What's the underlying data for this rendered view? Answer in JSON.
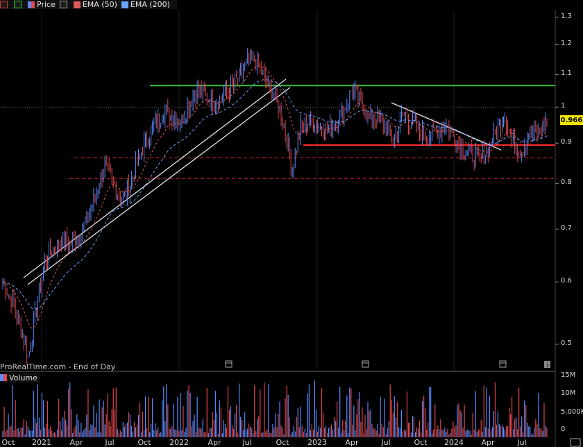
{
  "toolbar": {
    "price_label": "Price",
    "ema50_label": "EMA (50)",
    "ema200_label": "EMA (200)"
  },
  "source_label": "ProRealTime.com - End of Day",
  "volume_label": "Volume",
  "last_price": "0.966",
  "colors": {
    "background": "#000000",
    "up_candle": "#5b8cff",
    "down_candle": "#e0474c",
    "ema50": "#e05a5a",
    "ema200": "#6aa0ff",
    "resistance": "#39c639",
    "support": "#ff2a2a",
    "trendline": "#e8e8e8",
    "price_tag": "#f2e600"
  },
  "chart_data": {
    "type": "line",
    "y_axis_scale": "log",
    "price_ticks": [
      "1.3",
      "1.2",
      "1.1",
      "1",
      "0.9",
      "0.8",
      "0.7",
      "0.6",
      "0.5"
    ],
    "volume_ticks": [
      "15M",
      "10M",
      "5,000K",
      "0"
    ],
    "x_labels": [
      "Oct",
      "2021",
      "Apr",
      "Jul",
      "Oct",
      "2022",
      "Apr",
      "Jul",
      "Oct",
      "2023",
      "Apr",
      "Jul",
      "Oct",
      "2024",
      "Apr",
      "Jul"
    ],
    "series": [
      {
        "values": [
          0.6,
          0.57,
          0.53,
          0.48,
          0.56,
          0.64,
          0.66,
          0.68,
          0.67,
          0.69,
          0.72,
          0.78,
          0.84,
          0.8,
          0.76,
          0.8,
          0.86,
          0.92,
          0.95,
          0.99,
          0.97,
          0.96,
          1.02,
          1.05,
          1.03,
          1.01,
          1.04,
          1.06,
          1.1,
          1.15,
          1.14,
          1.07,
          1.03,
          0.96,
          0.83,
          0.94,
          0.96,
          0.95,
          0.93,
          0.96,
          0.98,
          1.05,
          1.02,
          0.97,
          0.97,
          0.94,
          0.91,
          0.98,
          0.96,
          0.93,
          0.92,
          0.93,
          0.95,
          0.92,
          0.89,
          0.87,
          0.86,
          0.88,
          0.93,
          0.98,
          0.9,
          0.88,
          0.93,
          0.92,
          0.966
        ]
      }
    ],
    "horizontal_levels": [
      {
        "value": 1.065,
        "style": "solid",
        "color": "#39c639"
      },
      {
        "value": 0.895,
        "style": "solid",
        "color": "#ff2a2a"
      },
      {
        "value": 0.862,
        "style": "dashed",
        "color": "#ff2a2a"
      },
      {
        "value": 0.812,
        "style": "dashed",
        "color": "#ff2a2a"
      },
      {
        "value": 1.0,
        "style": "dotted",
        "color": "#555555"
      }
    ]
  }
}
